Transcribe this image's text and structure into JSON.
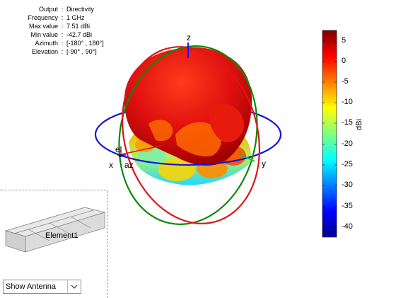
{
  "info": {
    "rows": [
      {
        "key": "Output",
        "value": "Directivity"
      },
      {
        "key": "Frequency",
        "value": "1 GHz"
      },
      {
        "key": "Max value",
        "value": "7.51 dBi"
      },
      {
        "key": "Min value",
        "value": "-42.7 dBi"
      },
      {
        "key": "Azimuth",
        "value": "[-180° , 180°]"
      },
      {
        "key": "Elevation",
        "value": "[-90° , 90°]"
      }
    ]
  },
  "axes": {
    "z": "z",
    "x": "x",
    "y": "y",
    "el": "el",
    "az": "az"
  },
  "colorbar": {
    "label": "dBi",
    "ticks": [
      "5",
      "0",
      "-5",
      "-10",
      "-15",
      "-20",
      "-25",
      "-30",
      "-35",
      "-40"
    ],
    "range": [
      -42.7,
      7.51
    ],
    "colormap": "jet"
  },
  "antenna_panel": {
    "label": "Element1"
  },
  "view_select": {
    "value": "Show Antenna"
  }
}
